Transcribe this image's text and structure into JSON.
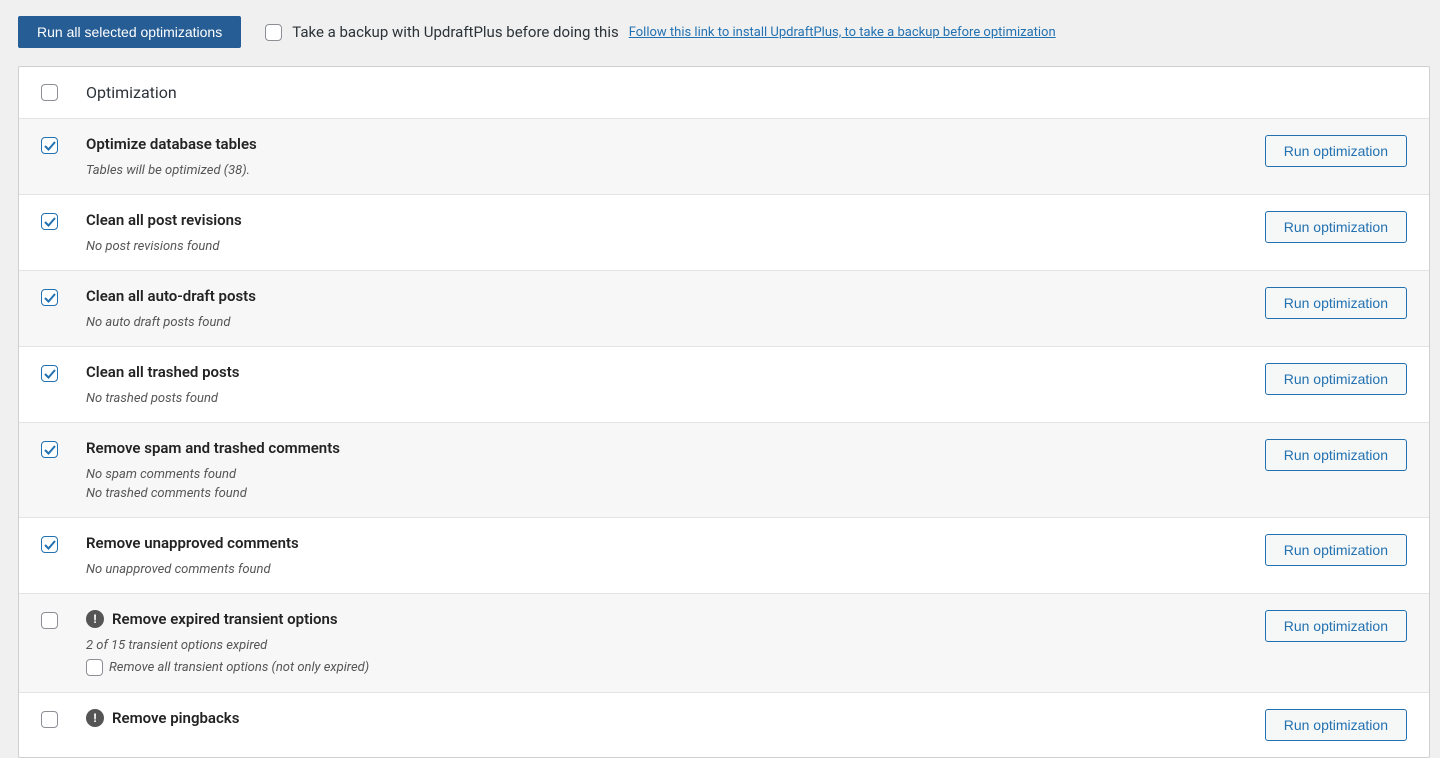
{
  "topbar": {
    "run_all_label": "Run all selected optimizations",
    "backup_label": "Take a backup with UpdraftPlus before doing this",
    "backup_link_text": "Follow this link to install UpdraftPlus, to take a backup before optimization"
  },
  "table": {
    "header": "Optimization",
    "run_button_label": "Run optimization",
    "rows": [
      {
        "checked": true,
        "alt": true,
        "warn": false,
        "title": "Optimize database tables",
        "desc": [
          "Tables will be optimized (38)."
        ]
      },
      {
        "checked": true,
        "alt": false,
        "warn": false,
        "title": "Clean all post revisions",
        "desc": [
          "No post revisions found"
        ]
      },
      {
        "checked": true,
        "alt": true,
        "warn": false,
        "title": "Clean all auto-draft posts",
        "desc": [
          "No auto draft posts found"
        ]
      },
      {
        "checked": true,
        "alt": false,
        "warn": false,
        "title": "Clean all trashed posts",
        "desc": [
          "No trashed posts found"
        ]
      },
      {
        "checked": true,
        "alt": true,
        "warn": false,
        "title": "Remove spam and trashed comments",
        "desc": [
          "No spam comments found",
          "No trashed comments found"
        ]
      },
      {
        "checked": true,
        "alt": false,
        "warn": false,
        "title": "Remove unapproved comments",
        "desc": [
          "No unapproved comments found"
        ]
      },
      {
        "checked": false,
        "alt": true,
        "warn": true,
        "title": "Remove expired transient options",
        "desc": [
          "2 of 15 transient options expired"
        ],
        "sub_option": "Remove all transient options (not only expired)"
      },
      {
        "checked": false,
        "alt": false,
        "warn": true,
        "title": "Remove pingbacks",
        "desc": []
      }
    ]
  }
}
